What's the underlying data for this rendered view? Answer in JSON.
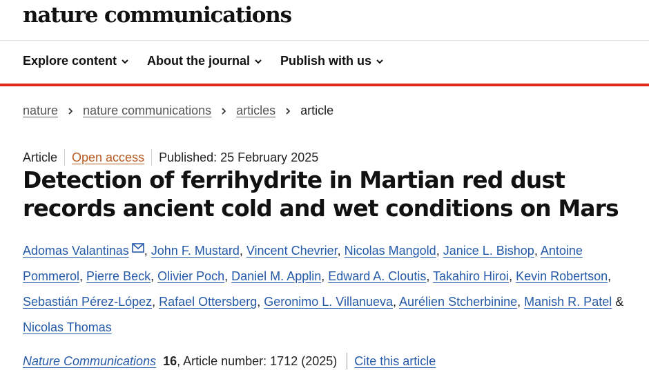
{
  "header": {
    "brand": "nature communications",
    "nav": [
      {
        "label": "Explore content",
        "icon": "chevron-down-icon"
      },
      {
        "label": "About the journal",
        "icon": "chevron-down-icon"
      },
      {
        "label": "Publish with us",
        "icon": "chevron-down-icon"
      }
    ],
    "accent_color": "#e0291a"
  },
  "breadcrumb": [
    "nature",
    "nature communications",
    "articles",
    "article"
  ],
  "article": {
    "type": "Article",
    "access": "Open access",
    "published": "Published: 25 February 2025",
    "title": "Detection of ferrihydrite in Martian red dust records ancient cold and wet conditions on Mars",
    "authors": [
      "Adomas Valantinas",
      "John F. Mustard",
      "Vincent Chevrier",
      "Nicolas Mangold",
      "Janice L. Bishop",
      "Antoine Pommerol",
      "Pierre Beck",
      "Olivier Poch",
      "Daniel M. Applin",
      "Edward A. Cloutis",
      "Takahiro Hiroi",
      "Kevin Robertson",
      "Sebastián Pérez-López",
      "Rafael Ottersberg",
      "Geronimo L. Villanueva",
      "Aurélien Stcherbinine",
      "Manish R. Patel",
      "Nicolas Thomas"
    ],
    "corresponding_author_icon": "mail-icon",
    "citation": {
      "journal": "Nature Communications",
      "volume": "16",
      "details": ", Article number: 1712 (2025)",
      "cite_label": "Cite this article"
    }
  },
  "colors": {
    "link": "#2459a8",
    "open_access": "#b85a1f"
  }
}
